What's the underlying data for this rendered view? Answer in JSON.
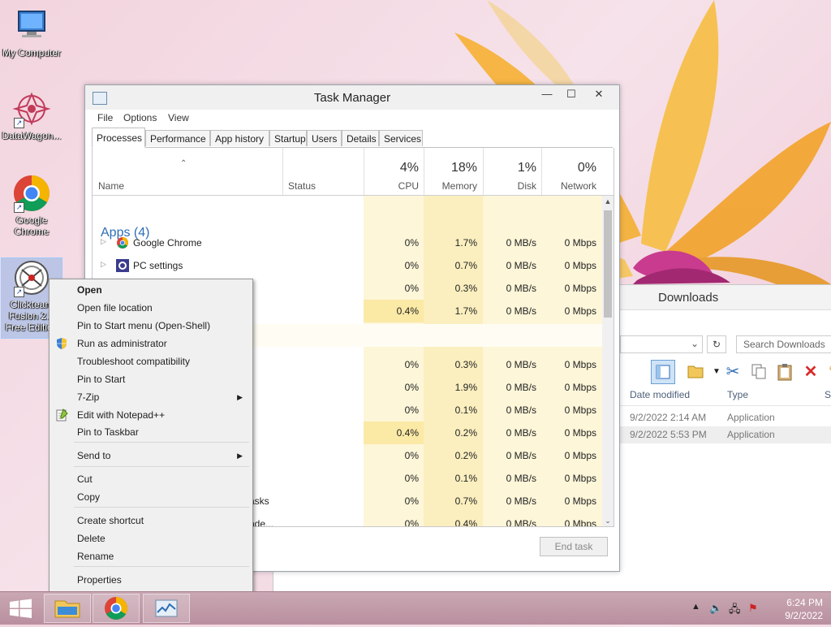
{
  "desktop": {
    "icons": [
      {
        "label": "My Computer"
      },
      {
        "label": "DataWagon..."
      },
      {
        "label": "Google Chrome"
      },
      {
        "label": "Clickteam Fusion 2.5 Free Edition"
      }
    ]
  },
  "downloads": {
    "title": "Downloads",
    "search_placeholder": "Search Downloads",
    "columns": [
      "Date modified",
      "Type",
      "Si"
    ],
    "rows": [
      {
        "date": "9/2/2022 2:14 AM",
        "type": "Application"
      },
      {
        "date": "9/2/2022 5:53 PM",
        "type": "Application"
      }
    ]
  },
  "task_manager": {
    "title": "Task Manager",
    "menu": [
      "File",
      "Options",
      "View"
    ],
    "tabs": [
      "Processes",
      "Performance",
      "App history",
      "Startup",
      "Users",
      "Details",
      "Services"
    ],
    "columns": {
      "name": "Name",
      "status": "Status",
      "cpu": {
        "pct": "4%",
        "label": "CPU"
      },
      "memory": {
        "pct": "18%",
        "label": "Memory"
      },
      "disk": {
        "pct": "1%",
        "label": "Disk"
      },
      "network": {
        "pct": "0%",
        "label": "Network"
      }
    },
    "group": "Apps (4)",
    "rows": [
      {
        "name": "Google Chrome",
        "cpu": "0%",
        "mem": "1.7%",
        "disk": "0 MB/s",
        "net": "0 Mbps"
      },
      {
        "name": "PC settings",
        "cpu": "0%",
        "mem": "0.7%",
        "disk": "0 MB/s",
        "net": "0 Mbps"
      },
      {
        "name": "Task M",
        "cpu": "0%",
        "mem": "0.3%",
        "disk": "0 MB/s",
        "net": "0 Mbps"
      },
      {
        "name": "",
        "cpu": "0.4%",
        "mem": "1.7%",
        "disk": "0 MB/s",
        "net": "0 Mbps"
      },
      {
        "name": "",
        "cpu": "",
        "mem": "",
        "disk": "",
        "net": ""
      },
      {
        "name": "",
        "cpu": "0%",
        "mem": "0.3%",
        "disk": "0 MB/s",
        "net": "0 Mbps"
      },
      {
        "name": "",
        "cpu": "0%",
        "mem": "1.9%",
        "disk": "0 MB/s",
        "net": "0 Mbps"
      },
      {
        "name": "",
        "cpu": "0%",
        "mem": "0.1%",
        "disk": "0 MB/s",
        "net": "0 Mbps"
      },
      {
        "name": "",
        "cpu": "0.4%",
        "mem": "0.2%",
        "disk": "0 MB/s",
        "net": "0 Mbps"
      },
      {
        "name": "",
        "cpu": "0%",
        "mem": "0.2%",
        "disk": "0 MB/s",
        "net": "0 Mbps"
      },
      {
        "name": "",
        "cpu": "0%",
        "mem": "0.1%",
        "disk": "0 MB/s",
        "net": "0 Mbps"
      },
      {
        "name": "asks",
        "cpu": "0%",
        "mem": "0.7%",
        "disk": "0 MB/s",
        "net": "0 Mbps"
      },
      {
        "name": "nde...",
        "cpu": "0%",
        "mem": "0.4%",
        "disk": "0 MB/s",
        "net": "0 Mbps"
      }
    ],
    "end_task": "End task"
  },
  "context_menu": {
    "items": [
      {
        "label": "Open",
        "bold": true
      },
      {
        "label": "Open file location"
      },
      {
        "label": "Pin to Start menu (Open-Shell)"
      },
      {
        "label": "Run as administrator",
        "icon": "shield-icon"
      },
      {
        "label": "Troubleshoot compatibility"
      },
      {
        "label": "Pin to Start"
      },
      {
        "label": "7-Zip",
        "submenu": true
      },
      {
        "label": "Edit with Notepad++",
        "icon": "notepad-icon"
      },
      {
        "label": "Pin to Taskbar"
      },
      {
        "label": "Send to",
        "submenu": true
      },
      {
        "label": "Cut"
      },
      {
        "label": "Copy"
      },
      {
        "label": "Create shortcut"
      },
      {
        "label": "Delete"
      },
      {
        "label": "Rename"
      },
      {
        "label": "Properties"
      }
    ]
  },
  "taskbar": {
    "time": "6:24 PM",
    "date": "9/2/2022"
  },
  "colors": {
    "accent_blue": "#2d6db5",
    "heat_light": "#fdf6d9",
    "heat_mid": "#fbefbf",
    "taskbar": "#b98f9e"
  }
}
